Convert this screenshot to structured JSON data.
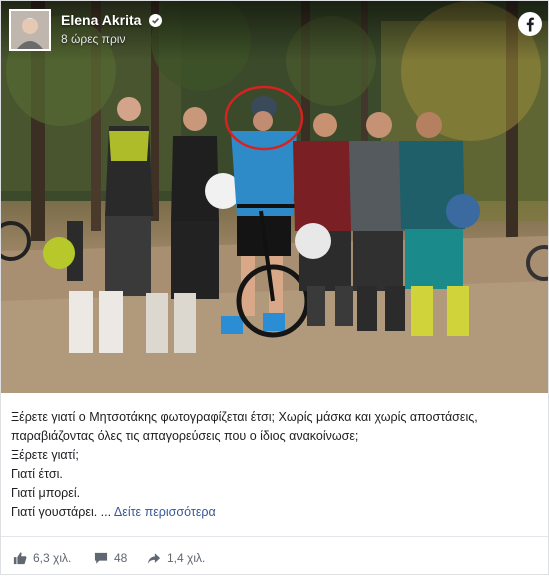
{
  "post": {
    "author": "Elena Akrita",
    "timestamp": "8 ώρες πριν",
    "text_lines": [
      "Ξέρετε γιατί ο Μητσοτάκης φωτογραφίζεται έτσι; Χωρίς μάσκα και χωρίς αποστάσεις,",
      "παραβιάζοντας όλες τις απαγορεύσεις που ο ίδιος ανακοίνωσε;",
      "Ξέρετε γιατί;",
      "Γιατί έτσι.",
      "Γιατί μπορεί.",
      "Γιατί γουστάρει. ..."
    ],
    "see_more": "Δείτε περισσότερα"
  },
  "stats": {
    "likes": "6,3 χιλ.",
    "comments": "48",
    "shares": "1,4 χιλ."
  },
  "colors": {
    "facebook_blue": "#1877f2",
    "link": "#385898",
    "highlight_circle": "#d8221f"
  },
  "icons": [
    "verified-badge-icon",
    "facebook-logo-icon",
    "like-icon",
    "comment-icon",
    "share-icon"
  ]
}
